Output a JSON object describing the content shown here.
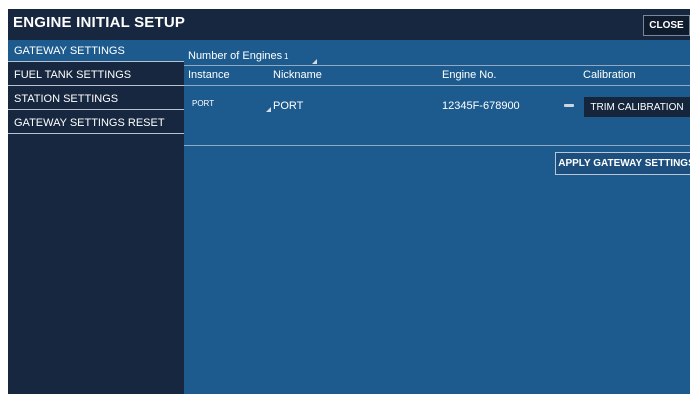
{
  "header": {
    "title": "ENGINE INITIAL SETUP",
    "close_label": "CLOSE"
  },
  "sidebar": {
    "items": [
      {
        "label": "GATEWAY SETTINGS",
        "active": true
      },
      {
        "label": "FUEL TANK SETTINGS",
        "active": false
      },
      {
        "label": "STATION SETTINGS",
        "active": false
      },
      {
        "label": "GATEWAY SETTINGS RESET",
        "active": false
      }
    ]
  },
  "gateway": {
    "engines_label": "Number of Engines",
    "engines_value": "1",
    "columns": [
      "Instance",
      "Nickname",
      "Engine No.",
      "Calibration"
    ],
    "rows": [
      {
        "instance": "PORT",
        "nickname": "PORT",
        "engine_no": "12345F-678900",
        "calibration_button": "TRIM CALIBRATION"
      }
    ],
    "apply_label": "APPLY GATEWAY SETTINGS"
  },
  "colors": {
    "panel": "#1d5b8f",
    "header": "#17273f",
    "button_dark": "#14253c"
  }
}
